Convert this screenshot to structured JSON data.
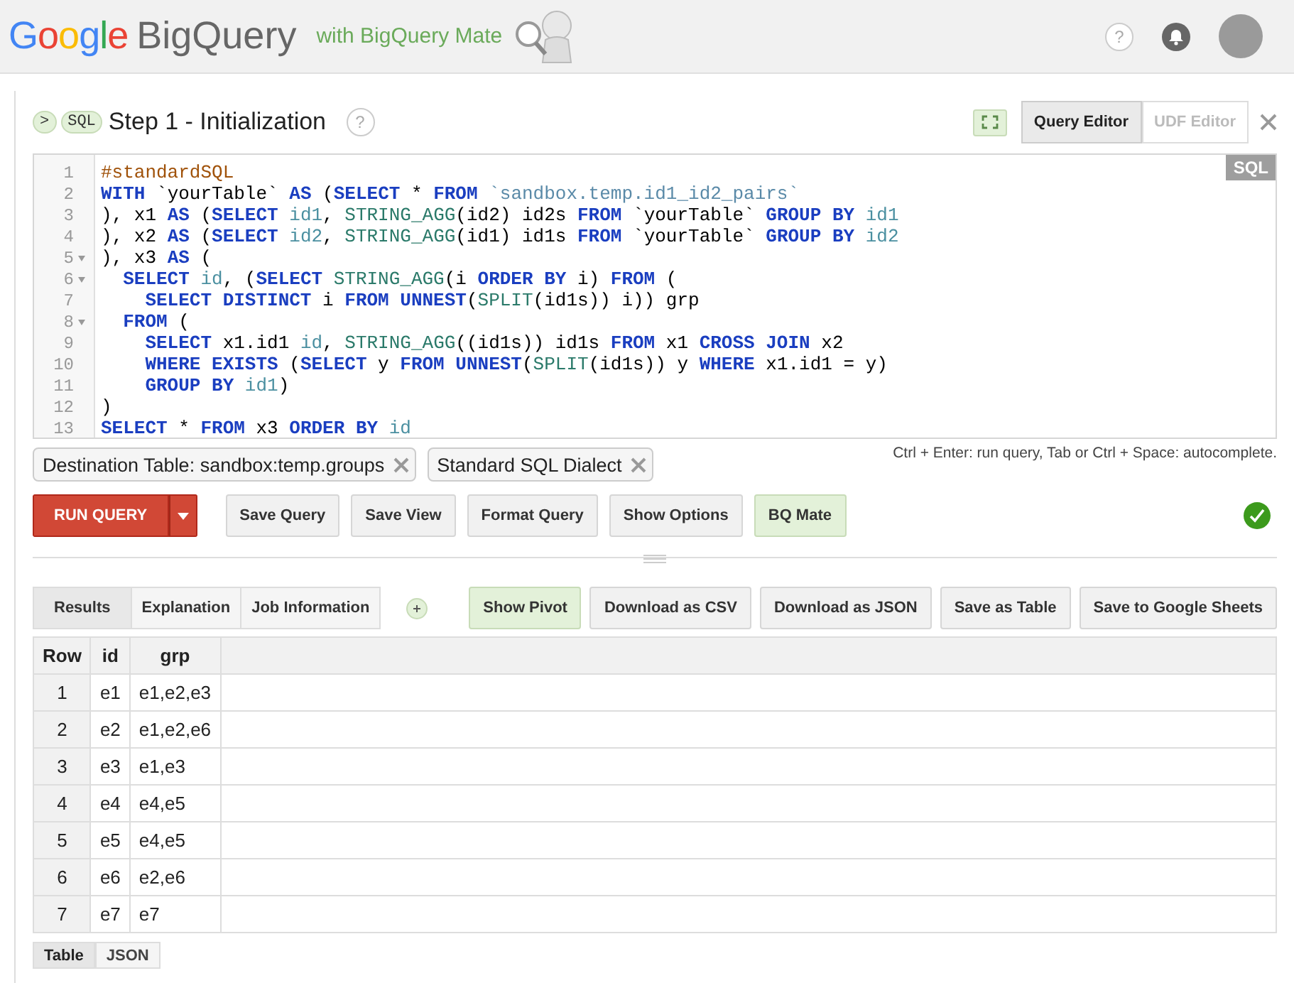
{
  "header": {
    "logo": "Google",
    "product": "BigQuery",
    "subtitle": "with BigQuery Mate",
    "help": "?"
  },
  "step": {
    "prompt": ">",
    "badge": "SQL",
    "title": "Step 1 - Initialization",
    "help": "?"
  },
  "editor_tabs": [
    {
      "label": "Query Editor",
      "selected": true
    },
    {
      "label": "UDF Editor",
      "selected": false
    }
  ],
  "editor": {
    "language": "SQL",
    "lines": [
      {
        "number": "1",
        "foldable": false,
        "tokens": [
          {
            "kind": "comment",
            "t": "#standardSQL"
          }
        ]
      },
      {
        "number": "2",
        "foldable": false,
        "tokens": [
          {
            "kind": "kw",
            "t": "WITH"
          },
          {
            "kind": "plain",
            "t": " `yourTable` "
          },
          {
            "kind": "kw",
            "t": "AS"
          },
          {
            "kind": "plain",
            "t": " ("
          },
          {
            "kind": "kw",
            "t": "SELECT"
          },
          {
            "kind": "plain",
            "t": " * "
          },
          {
            "kind": "kw",
            "t": "FROM "
          },
          {
            "kind": "str",
            "t": "`sandbox.temp.id1_id2_pairs`"
          }
        ]
      },
      {
        "number": "3",
        "foldable": false,
        "tokens": [
          {
            "kind": "plain",
            "t": "), x1 "
          },
          {
            "kind": "kw",
            "t": "AS"
          },
          {
            "kind": "plain",
            "t": " ("
          },
          {
            "kind": "kw",
            "t": "SELECT "
          },
          {
            "kind": "field",
            "t": "id1"
          },
          {
            "kind": "plain",
            "t": ", "
          },
          {
            "kind": "fn",
            "t": "STRING_AGG"
          },
          {
            "kind": "plain",
            "t": "(id2) id2s "
          },
          {
            "kind": "kw",
            "t": "FROM"
          },
          {
            "kind": "plain",
            "t": " `yourTable` "
          },
          {
            "kind": "kw",
            "t": "GROUP BY "
          },
          {
            "kind": "field",
            "t": "id1"
          }
        ]
      },
      {
        "number": "4",
        "foldable": false,
        "tokens": [
          {
            "kind": "plain",
            "t": "), x2 "
          },
          {
            "kind": "kw",
            "t": "AS"
          },
          {
            "kind": "plain",
            "t": " ("
          },
          {
            "kind": "kw",
            "t": "SELECT "
          },
          {
            "kind": "field",
            "t": "id2"
          },
          {
            "kind": "plain",
            "t": ", "
          },
          {
            "kind": "fn",
            "t": "STRING_AGG"
          },
          {
            "kind": "plain",
            "t": "(id1) id1s "
          },
          {
            "kind": "kw",
            "t": "FROM"
          },
          {
            "kind": "plain",
            "t": " `yourTable` "
          },
          {
            "kind": "kw",
            "t": "GROUP BY "
          },
          {
            "kind": "field",
            "t": "id2"
          }
        ]
      },
      {
        "number": "5",
        "foldable": true,
        "tokens": [
          {
            "kind": "plain",
            "t": "), x3 "
          },
          {
            "kind": "kw",
            "t": "AS"
          },
          {
            "kind": "plain",
            "t": " ("
          }
        ]
      },
      {
        "number": "6",
        "foldable": true,
        "tokens": [
          {
            "kind": "kw",
            "t": "  SELECT "
          },
          {
            "kind": "field",
            "t": "id"
          },
          {
            "kind": "plain",
            "t": ", ("
          },
          {
            "kind": "kw",
            "t": "SELECT "
          },
          {
            "kind": "fn",
            "t": "STRING_AGG"
          },
          {
            "kind": "plain",
            "t": "(i "
          },
          {
            "kind": "kw",
            "t": "ORDER BY"
          },
          {
            "kind": "plain",
            "t": " i) "
          },
          {
            "kind": "kw",
            "t": "FROM"
          },
          {
            "kind": "plain",
            "t": " ("
          }
        ]
      },
      {
        "number": "7",
        "foldable": false,
        "tokens": [
          {
            "kind": "kw",
            "t": "    SELECT DISTINCT"
          },
          {
            "kind": "plain",
            "t": " i "
          },
          {
            "kind": "kw",
            "t": "FROM UNNEST"
          },
          {
            "kind": "plain",
            "t": "("
          },
          {
            "kind": "fn",
            "t": "SPLIT"
          },
          {
            "kind": "plain",
            "t": "(id1s)) i)) grp"
          }
        ]
      },
      {
        "number": "8",
        "foldable": true,
        "tokens": [
          {
            "kind": "kw",
            "t": "  FROM"
          },
          {
            "kind": "plain",
            "t": " ("
          }
        ]
      },
      {
        "number": "9",
        "foldable": false,
        "tokens": [
          {
            "kind": "kw",
            "t": "    SELECT"
          },
          {
            "kind": "plain",
            "t": " x1.id1 "
          },
          {
            "kind": "field",
            "t": "id"
          },
          {
            "kind": "plain",
            "t": ", "
          },
          {
            "kind": "fn",
            "t": "STRING_AGG"
          },
          {
            "kind": "plain",
            "t": "((id1s)) id1s "
          },
          {
            "kind": "kw",
            "t": "FROM"
          },
          {
            "kind": "plain",
            "t": " x1 "
          },
          {
            "kind": "kw",
            "t": "CROSS JOIN"
          },
          {
            "kind": "plain",
            "t": " x2"
          }
        ]
      },
      {
        "number": "10",
        "foldable": false,
        "tokens": [
          {
            "kind": "kw",
            "t": "    WHERE EXISTS"
          },
          {
            "kind": "plain",
            "t": " ("
          },
          {
            "kind": "kw",
            "t": "SELECT"
          },
          {
            "kind": "plain",
            "t": " y "
          },
          {
            "kind": "kw",
            "t": "FROM UNNEST"
          },
          {
            "kind": "plain",
            "t": "("
          },
          {
            "kind": "fn",
            "t": "SPLIT"
          },
          {
            "kind": "plain",
            "t": "(id1s)) y "
          },
          {
            "kind": "kw",
            "t": "WHERE"
          },
          {
            "kind": "plain",
            "t": " x1.id1 = y)"
          }
        ]
      },
      {
        "number": "11",
        "foldable": false,
        "tokens": [
          {
            "kind": "kw",
            "t": "    GROUP BY "
          },
          {
            "kind": "field",
            "t": "id1"
          },
          {
            "kind": "plain",
            "t": ")"
          }
        ]
      },
      {
        "number": "12",
        "foldable": false,
        "tokens": [
          {
            "kind": "plain",
            "t": ")"
          }
        ]
      },
      {
        "number": "13",
        "foldable": false,
        "tokens": [
          {
            "kind": "kw",
            "t": "SELECT"
          },
          {
            "kind": "plain",
            "t": " * "
          },
          {
            "kind": "kw",
            "t": "FROM"
          },
          {
            "kind": "plain",
            "t": " x3 "
          },
          {
            "kind": "kw",
            "t": "ORDER BY "
          },
          {
            "kind": "field",
            "t": "id"
          }
        ]
      }
    ]
  },
  "chips": [
    "Destination Table: sandbox:temp.groups",
    "Standard SQL Dialect"
  ],
  "hint": "Ctrl + Enter: run query, Tab or Ctrl + Space: autocomplete.",
  "run_button": "RUN QUERY",
  "buttons": [
    {
      "label": "Save Query",
      "on": false
    },
    {
      "label": "Save View",
      "on": false
    },
    {
      "label": "Format Query",
      "on": false
    },
    {
      "label": "Show Options",
      "on": false
    },
    {
      "label": "BQ Mate",
      "on": true
    }
  ],
  "result_tabs": [
    {
      "label": "Results",
      "selected": true
    },
    {
      "label": "Explanation",
      "selected": false
    },
    {
      "label": "Job Information",
      "selected": false
    }
  ],
  "result_buttons": [
    {
      "label": "Show Pivot",
      "on": true
    },
    {
      "label": "Download as CSV",
      "on": false
    },
    {
      "label": "Download as JSON",
      "on": false
    },
    {
      "label": "Save as Table",
      "on": false
    },
    {
      "label": "Save to Google Sheets",
      "on": false
    }
  ],
  "table": {
    "columns": [
      "Row",
      "id",
      "grp"
    ],
    "rows": [
      [
        "1",
        "e1",
        "e1,e2,e3"
      ],
      [
        "2",
        "e2",
        "e1,e2,e6"
      ],
      [
        "3",
        "e3",
        "e1,e3"
      ],
      [
        "4",
        "e4",
        "e4,e5"
      ],
      [
        "5",
        "e5",
        "e4,e5"
      ],
      [
        "6",
        "e6",
        "e2,e6"
      ],
      [
        "7",
        "e7",
        "e7"
      ]
    ]
  },
  "view_tabs": [
    {
      "label": "Table",
      "selected": true
    },
    {
      "label": "JSON",
      "selected": false
    }
  ]
}
